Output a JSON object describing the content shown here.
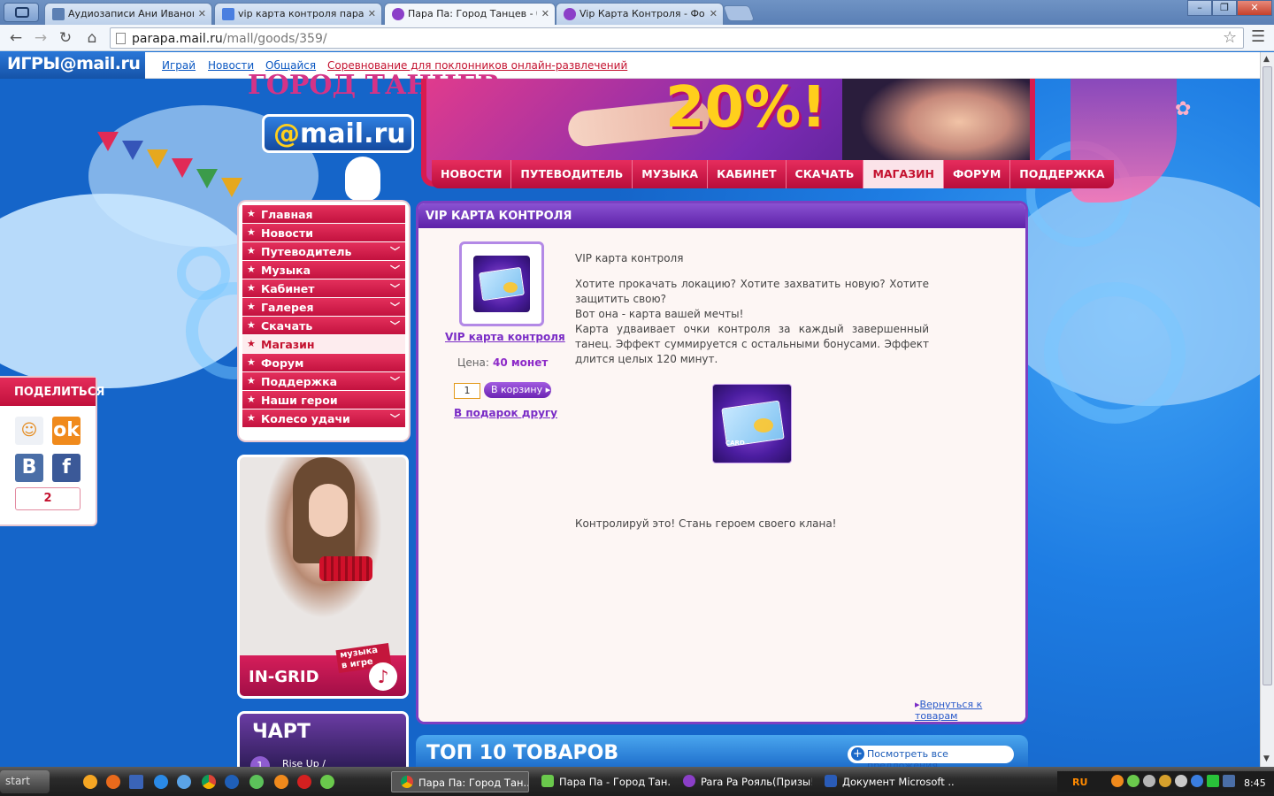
{
  "browser": {
    "tabs": [
      {
        "label": "Аудиозаписи Ани Ивановой",
        "icon": "vk-icon"
      },
      {
        "label": "vip карта контроля пара па",
        "icon": "google-icon"
      },
      {
        "label": "Пара Па: Город Танцев - бе",
        "icon": "parapa-icon",
        "active": true
      },
      {
        "label": "Vip Карта Контроля - Фору",
        "icon": "parapa-icon"
      }
    ],
    "address": {
      "host": "parapa.mail.ru",
      "path": "/mall/goods/359/"
    },
    "window_controls": {
      "minimize": "–",
      "restore": "❐",
      "close": "✕"
    }
  },
  "mailbar": {
    "logo_main": "ИГРЫ",
    "logo_brand": "@mail.ru",
    "links": [
      "Играй",
      "Новости",
      "Общайся"
    ],
    "promo_link": "Соревнование для поклонников онлайн-развлечений"
  },
  "header": {
    "game_title": "ГОРОД ТАНЦЕВ",
    "site_logo_at": "@",
    "site_logo_text": "mail.ru",
    "banner_discount": "20%!"
  },
  "topnav": [
    "НОВОСТИ",
    "ПУТЕВОДИТЕЛЬ",
    "МУЗЫКА",
    "КАБИНЕТ",
    "СКАЧАТЬ",
    "МАГАЗИН",
    "ФОРУМ",
    "ПОДДЕРЖКА"
  ],
  "topnav_active": "МАГАЗИН",
  "leftmenu": [
    {
      "label": "Главная",
      "expandable": false
    },
    {
      "label": "Новости",
      "expandable": false
    },
    {
      "label": "Путеводитель",
      "expandable": true
    },
    {
      "label": "Музыка",
      "expandable": true
    },
    {
      "label": "Кабинет",
      "expandable": true
    },
    {
      "label": "Галерея",
      "expandable": true
    },
    {
      "label": "Скачать",
      "expandable": true
    },
    {
      "label": "Магазин",
      "expandable": false,
      "active": true
    },
    {
      "label": "Форум",
      "expandable": false
    },
    {
      "label": "Поддержка",
      "expandable": true
    },
    {
      "label": "Наши герои",
      "expandable": false
    },
    {
      "label": "Колесо удачи",
      "expandable": true
    }
  ],
  "promo": {
    "title": "IN-GRID",
    "tag": "музыка в игре"
  },
  "chart": {
    "title": "ЧАРТ",
    "first_rank": "1",
    "first_song": "Rise Up /"
  },
  "share": {
    "title": "ПОДЕЛИТЬСЯ",
    "count": "2"
  },
  "product": {
    "panel_title": "VIP КАРТА КОНТРОЛЯ",
    "name": "VIP карта контроля",
    "price_label": "Цена:",
    "price_value": "40 монет",
    "quantity": "1",
    "cart_button": "В корзину",
    "gift_link": "В подарок другу",
    "desc_title": "VIP карта контроля",
    "desc_lines": [
      "Хотите прокачать локацию? Хотите захватить новую? Хотите защитить свою?",
      "Вот она - карта вашей мечты!",
      "Карта удваивает очки контроля за каждый завершенный танец. Эффект суммируется с остальными бонусами. Эффект длится целых 120 минут."
    ],
    "slogan": "Контролируй это! Стань героем своего клана!",
    "card_caption": "CARD",
    "back_link": "Вернуться к товарам"
  },
  "top10": {
    "title": "ТОП 10 ТОВАРОВ",
    "all_link": "Посмотреть все предложения"
  },
  "taskbar": {
    "start": "start",
    "windows": [
      {
        "label": "Пара Па: Город Тан...",
        "active": true
      },
      {
        "label": "Пара Па - Город Тан..."
      },
      {
        "label": "Para Pa Рояль(Призы!)"
      },
      {
        "label": "Документ Microsoft ..."
      }
    ],
    "lang": "RU",
    "clock": "8:45"
  },
  "colors": {
    "accent_red": "#c4122f",
    "accent_purple": "#7c3fc2",
    "sky_blue": "#1e7de3"
  }
}
